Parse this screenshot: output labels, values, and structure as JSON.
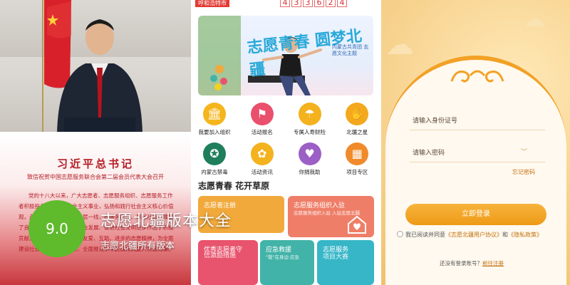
{
  "panel_news": {
    "title": "习近平总书记",
    "subtitle": "致信祝贺中国志愿服务联合会第二届会员代表大会召开",
    "body": "党的十八大以来，广大志愿者、志愿服务组织、志愿服务工作者积极投身中国特色社会主义事业，弘扬和践行社会主义核心价值观，走进城乡社区、深入基层一线，在服务群众、奉献社会中展现了良好形象，为推动经济社会发展、促进社会文明进步作出了积极贡献。希望你们弘扬奉献、友爱、互助、进步的志愿精神，为全面建设社会主义现代化国家、全面推进中华民族伟大复兴贡献力量。"
  },
  "panel_home": {
    "city": "呼和浩特市",
    "counter_digits": [
      "4",
      "3",
      "3",
      "6",
      "2",
      "4"
    ],
    "banner_title": "志愿青春 圆梦北疆",
    "banner_org": "内蒙古共青团 志愿文化主题",
    "grid": [
      {
        "label": "我要加入组织",
        "icon": "pillar-icon",
        "color": "#f5b51c"
      },
      {
        "label": "活动报名",
        "icon": "flag-icon",
        "color": "#ea4f6b"
      },
      {
        "label": "专属人寿财险",
        "icon": "umbrella-icon",
        "color": "#f3b21e"
      },
      {
        "label": "北疆之星",
        "icon": "hand-icon",
        "color": "#f3a81e"
      },
      {
        "label": "内蒙古禁毒",
        "icon": "emblem-icon",
        "color": "#1f7f5a"
      },
      {
        "label": "活动资讯",
        "icon": "sunflower-icon",
        "color": "#f3b21e"
      },
      {
        "label": "你捐我助",
        "icon": "heart-icon",
        "color": "#9b5fc6"
      },
      {
        "label": "项目专区",
        "icon": "blocks-icon",
        "color": "#f08a2a"
      }
    ],
    "section_title": "志愿青春 花开草原",
    "tiles": [
      {
        "title": "志愿者注册",
        "desc": "",
        "color": "#f2a93b"
      },
      {
        "title": "志愿服务组织入驻",
        "desc": "志愿服务组织入驻 入驻志愿北疆",
        "color": "#ef7e68"
      },
      {
        "title": "优秀志愿者守",
        "desc": "信激励措施",
        "color": "#e8536d"
      },
      {
        "title": "应急救援",
        "desc": "\"我\"在身边 应急",
        "color": "#42b3a8"
      },
      {
        "title": "志愿服务",
        "desc": "项目大赛",
        "color": "#37b6c7"
      }
    ],
    "banner_dots": 5,
    "banner_active_dot": 1
  },
  "panel_login": {
    "id_placeholder": "请输入身份证号",
    "password_placeholder": "请输入密码",
    "forgot": "忘记密码",
    "login_button": "立即登录",
    "agree_prefix": "我已阅读并同意",
    "agree_link1": "《志愿北疆用户协议》",
    "agree_and": "和",
    "agree_link2": "《隐私政策》",
    "register_prefix": "还没有登录账号？",
    "register_link": "前往注册"
  },
  "overlay": {
    "score": "9.0",
    "title": "志愿北疆版本大全",
    "subtitle": "志愿北疆所有版本"
  },
  "colors": {
    "brand_red": "#b31d25",
    "orange": "#ee9a16",
    "score_green": "#5fba2c"
  }
}
